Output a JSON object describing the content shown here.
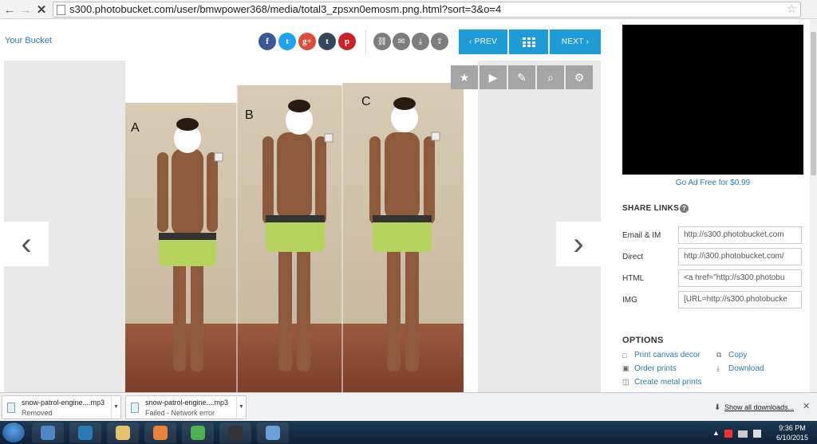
{
  "browser": {
    "url": "s300.photobucket.com/user/bmwpower368/media/total3_zpsxn0emosm.png.html?sort=3&o=4",
    "back_glyph": "←",
    "forward_glyph": "→",
    "stop_glyph": "✕",
    "bookmark_glyph": "☆"
  },
  "toolbar": {
    "your_bucket": "Your Bucket",
    "social": [
      {
        "icon": "facebook-icon",
        "glyph": "f",
        "color": "#3b5998"
      },
      {
        "icon": "twitter-icon",
        "glyph": "t",
        "color": "#1da1f2"
      },
      {
        "icon": "google-plus-icon",
        "glyph": "g+",
        "color": "#dd4b39"
      },
      {
        "icon": "tumblr-icon",
        "glyph": "t",
        "color": "#35465c"
      },
      {
        "icon": "pinterest-icon",
        "glyph": "p",
        "color": "#cb2027"
      }
    ],
    "tools": [
      "link-icon",
      "email-icon",
      "download-icon",
      "share-icon"
    ],
    "prev": "‹ PREV",
    "next": "NEXT ›",
    "accent": "#1e9cd7"
  },
  "viewer": {
    "labels": [
      "A",
      "B",
      "C"
    ],
    "left_arrow": "‹",
    "right_arrow": "›",
    "controls": [
      "favorite-star-icon",
      "slideshow-play-icon",
      "edit-icon",
      "zoom-icon",
      "settings-gear-icon"
    ]
  },
  "sidebar": {
    "ad_free": "Go Ad Free for $0.99",
    "share_links": {
      "title": "SHARE LINKS",
      "help": "?",
      "rows": [
        {
          "label": "Email & IM",
          "value": "http://s300.photobucket.com"
        },
        {
          "label": "Direct",
          "value": "http://i300.photobucket.com/"
        },
        {
          "label": "HTML",
          "value": "<a href=\"http://s300.photobu"
        },
        {
          "label": "IMG",
          "value": "[URL=http://s300.photobucke"
        }
      ]
    },
    "options": {
      "title": "OPTIONS",
      "items": [
        {
          "label": "Print canvas decor",
          "icon": "print-canvas-icon",
          "glyph": "□"
        },
        {
          "label": "Copy",
          "icon": "copy-icon",
          "glyph": "⧉"
        },
        {
          "label": "Order prints",
          "icon": "cart-icon",
          "glyph": "▣"
        },
        {
          "label": "Download",
          "icon": "download-icon",
          "glyph": "⤓"
        },
        {
          "label": "Create metal prints",
          "icon": "metal-prints-icon",
          "glyph": "◫"
        }
      ]
    }
  },
  "downloads": {
    "items": [
      {
        "name": "snow-patrol-engine....mp3",
        "status": "Removed"
      },
      {
        "name": "snow-patrol-engine....mp3",
        "status": "Failed - Network error"
      }
    ],
    "show_all": "Show all downloads...",
    "close": "✕"
  },
  "taskbar": {
    "time": "9:36 PM",
    "date": "6/10/2015",
    "apps": [
      "explorer-icon",
      "ie-icon",
      "folder-icon",
      "media-player-icon",
      "chrome-icon",
      "steam-icon",
      "photo-viewer-icon"
    ]
  }
}
